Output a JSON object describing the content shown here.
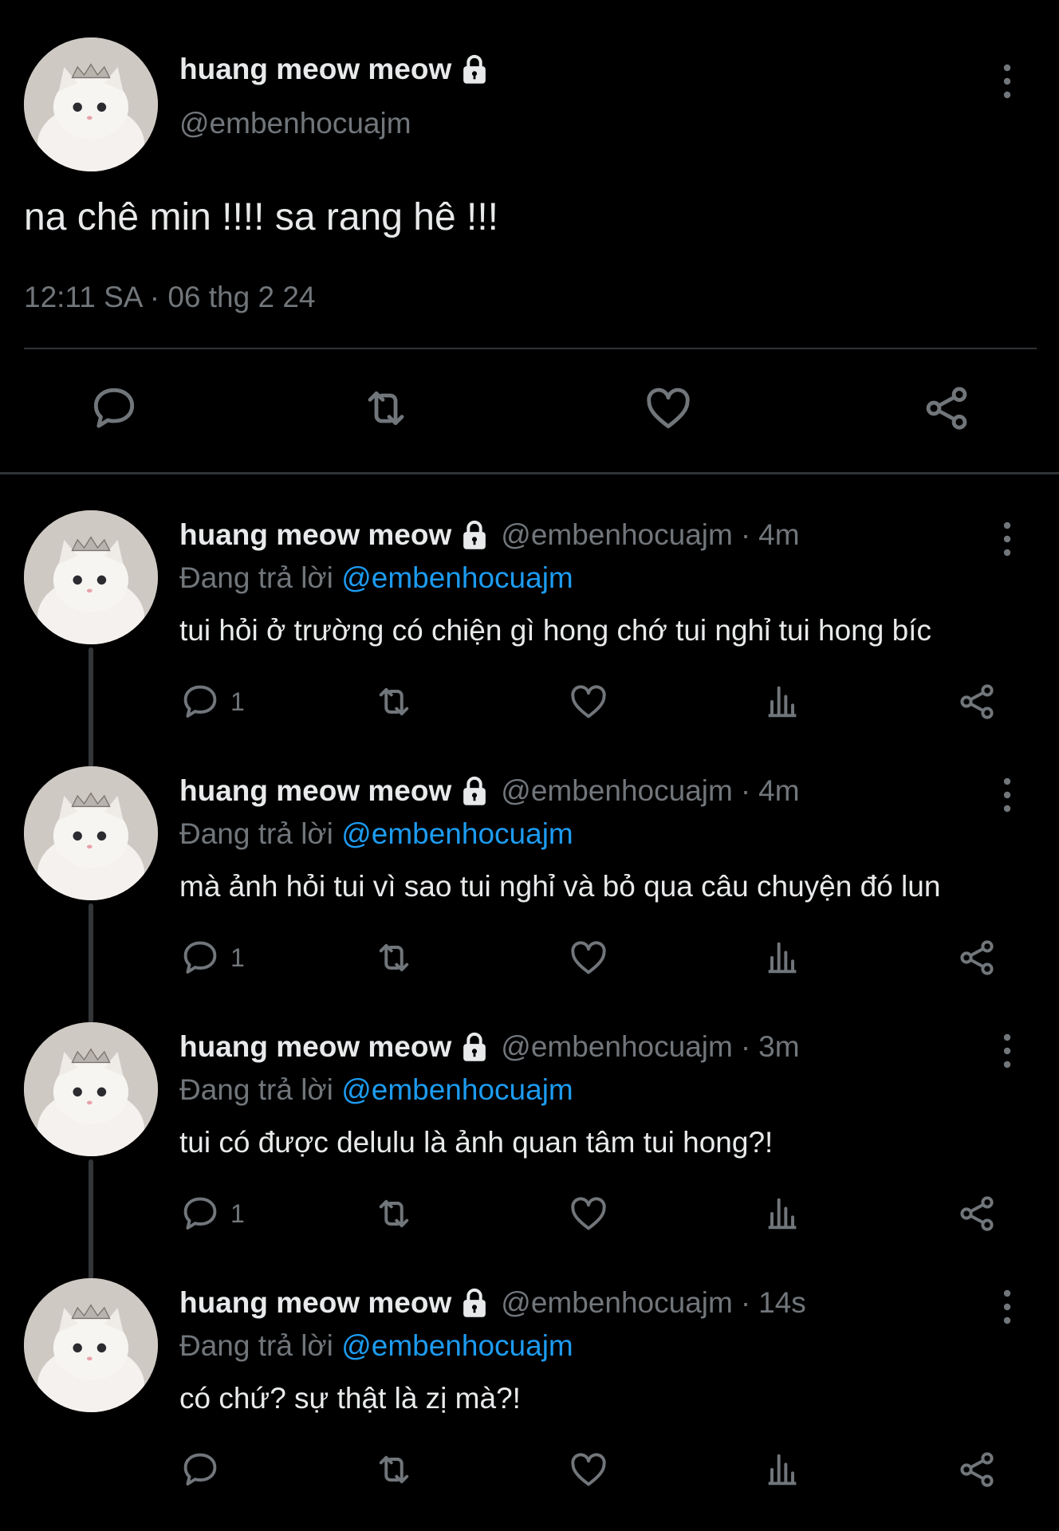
{
  "main_tweet": {
    "display_name": "huang meow meow",
    "handle": "@embenhocuajm",
    "text": "na chê min !!!! sa rang hê !!!",
    "timestamp": "12:11 SA · 06 thg 2 24",
    "icons": [
      "lock-icon",
      "more-vertical-icon",
      "reply-icon",
      "retweet-icon",
      "like-icon",
      "share-icon"
    ]
  },
  "replies": [
    {
      "display_name": "huang meow meow",
      "handle": "@embenhocuajm",
      "time": "4m",
      "replying_label": "Đang trả lời",
      "replying_to": "@embenhocuajm",
      "text": "tui hỏi ở trường có chiện gì hong chớ tui nghỉ tui hong bíc",
      "reply_count": "1"
    },
    {
      "display_name": "huang meow meow",
      "handle": "@embenhocuajm",
      "time": "4m",
      "replying_label": "Đang trả lời",
      "replying_to": "@embenhocuajm",
      "text": "mà ảnh hỏi tui vì sao tui nghỉ và bỏ qua câu chuyện đó lun",
      "reply_count": "1"
    },
    {
      "display_name": "huang meow meow",
      "handle": "@embenhocuajm",
      "time": "3m",
      "replying_label": "Đang trả lời",
      "replying_to": "@embenhocuajm",
      "text": "tui có được delulu là ảnh quan tâm tui hong?!",
      "reply_count": "1"
    },
    {
      "display_name": "huang meow meow",
      "handle": "@embenhocuajm",
      "time": "14s",
      "replying_label": "Đang trả lời",
      "replying_to": "@embenhocuajm",
      "text": "có chứ? sự thật là zị mà?!",
      "reply_count": ""
    }
  ],
  "colors": {
    "background": "#000000",
    "text_primary": "#e7e9ea",
    "text_secondary": "#71767b",
    "accent": "#1d9bf0",
    "divider": "#2f3336"
  }
}
